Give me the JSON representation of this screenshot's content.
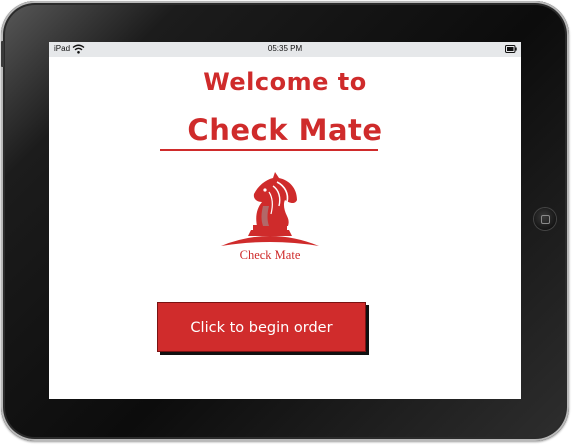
{
  "status_bar": {
    "carrier": "iPad",
    "time": "05:35 PM",
    "icons": [
      "wifi-icon",
      "battery-icon"
    ]
  },
  "welcome": {
    "line1": "Welcome to",
    "title": "Check Mate"
  },
  "logo": {
    "icon": "chess-knight-icon",
    "caption": "Check Mate"
  },
  "begin_button": {
    "label": "Click to begin order"
  },
  "colors": {
    "brand_red": "#cf2b2b",
    "button_red": "#d02c2c",
    "status_bar_bg": "#e6e8ea",
    "device_frame": "#111111"
  }
}
